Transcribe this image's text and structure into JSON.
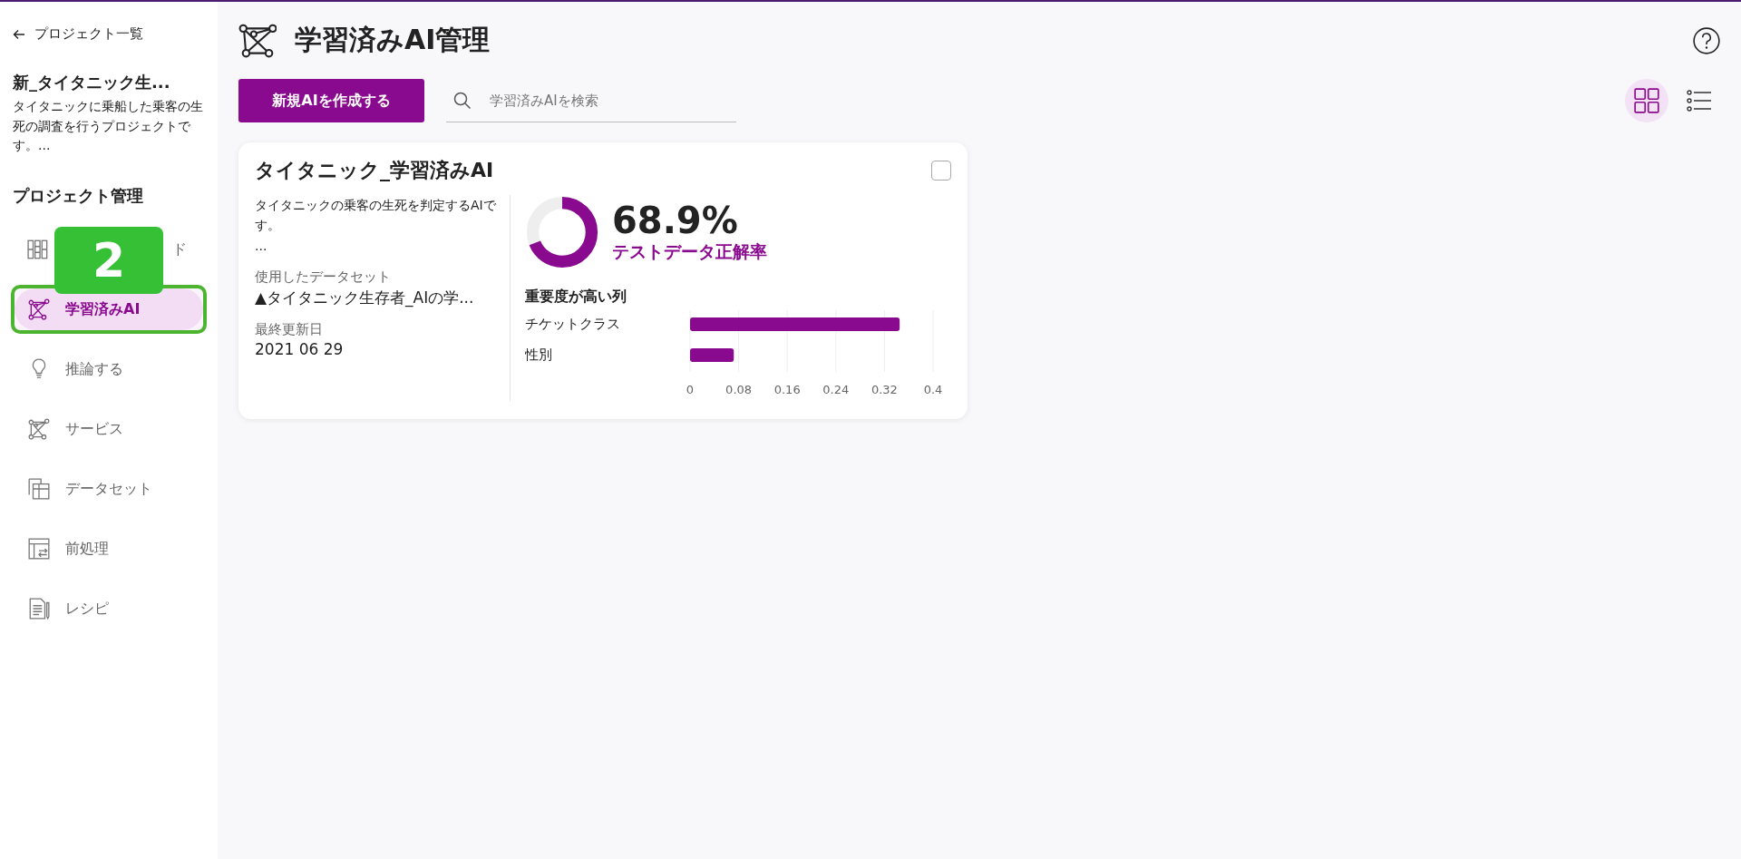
{
  "sidebar": {
    "back_link": "プロジェクト一覧",
    "project": {
      "title": "新_タイタニック生...",
      "description": "タイタニックに乗船した乗客の生死の調査を行うプロジェクトです。..."
    },
    "section_title": "プロジェクト管理",
    "items": [
      {
        "label": "ド",
        "selected": false
      },
      {
        "label": "学習済みAI",
        "selected": true
      },
      {
        "label": "推論する",
        "selected": false
      },
      {
        "label": "サービス",
        "selected": false
      },
      {
        "label": "データセット",
        "selected": false
      },
      {
        "label": "前処理",
        "selected": false
      },
      {
        "label": "レシピ",
        "selected": false
      }
    ]
  },
  "annotation": {
    "step": "2"
  },
  "header": {
    "title": "学習済みAI管理",
    "create_button": "新規AIを作成する",
    "search": {
      "placeholder": "学習済みAIを検索"
    },
    "views": [
      {
        "kind": "grid",
        "selected": true
      },
      {
        "kind": "list",
        "selected": false
      }
    ]
  },
  "cards": [
    {
      "title": "タイタニック_学習済みAI",
      "checked": false,
      "description": "タイタニックの乗客の生死を判定するAIです。",
      "more": "...",
      "dataset_label": "使用したデータセット",
      "dataset": "▲タイタニック生存者_AIの学...",
      "updated_label": "最終更新日",
      "updated": "2021 06 29",
      "accuracy": {
        "level": 0.689,
        "value": "68.9%",
        "label": "テストデータ正解率"
      },
      "importance_title": "重要度が高い列",
      "chart_data": {
        "type": "bar",
        "orientation": "horizontal",
        "categories": [
          "チケットクラス",
          "性別"
        ],
        "series": [
          {
            "color": "#8a0a8f",
            "values": [
              0.345,
              0.072
            ]
          }
        ],
        "grid": true,
        "xlim": [
          0,
          0.4
        ],
        "xticks": [
          0,
          0.08,
          0.16,
          0.24,
          0.32,
          0.4
        ]
      }
    }
  ]
}
